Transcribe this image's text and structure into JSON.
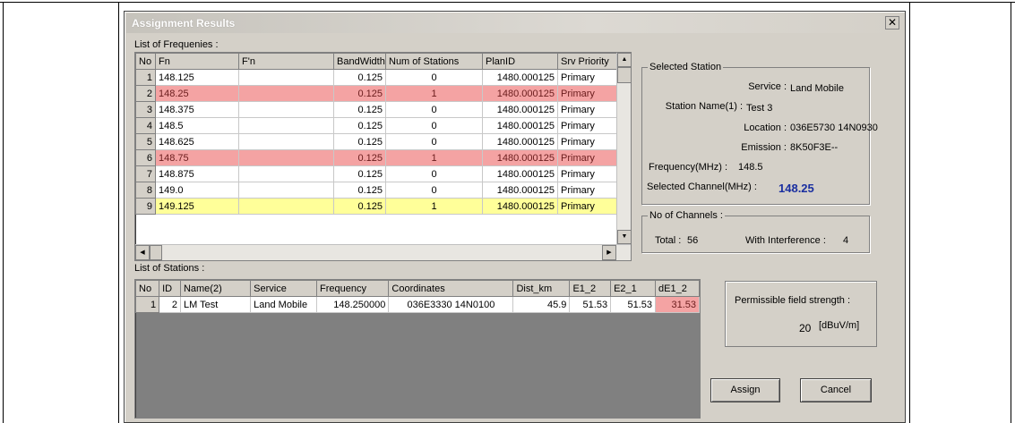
{
  "window": {
    "title": "Assignment Results"
  },
  "frequencies": {
    "label": "List of Frequenies :",
    "columns": [
      "No",
      "Fn",
      "F'n",
      "BandWidth",
      "Num of Stations",
      "PlanID",
      "Srv Priority"
    ],
    "rows": [
      {
        "no": "1",
        "fn": "148.125",
        "fpn": "",
        "bw": "0.125",
        "num": "0",
        "plan": "1480.000125",
        "prio": "Primary",
        "hl": ""
      },
      {
        "no": "2",
        "fn": "148.25",
        "fpn": "",
        "bw": "0.125",
        "num": "1",
        "plan": "1480.000125",
        "prio": "Primary",
        "hl": "pink"
      },
      {
        "no": "3",
        "fn": "148.375",
        "fpn": "",
        "bw": "0.125",
        "num": "0",
        "plan": "1480.000125",
        "prio": "Primary",
        "hl": ""
      },
      {
        "no": "4",
        "fn": "148.5",
        "fpn": "",
        "bw": "0.125",
        "num": "0",
        "plan": "1480.000125",
        "prio": "Primary",
        "hl": ""
      },
      {
        "no": "5",
        "fn": "148.625",
        "fpn": "",
        "bw": "0.125",
        "num": "0",
        "plan": "1480.000125",
        "prio": "Primary",
        "hl": ""
      },
      {
        "no": "6",
        "fn": "148.75",
        "fpn": "",
        "bw": "0.125",
        "num": "1",
        "plan": "1480.000125",
        "prio": "Primary",
        "hl": "pink"
      },
      {
        "no": "7",
        "fn": "148.875",
        "fpn": "",
        "bw": "0.125",
        "num": "0",
        "plan": "1480.000125",
        "prio": "Primary",
        "hl": ""
      },
      {
        "no": "8",
        "fn": "149.0",
        "fpn": "",
        "bw": "0.125",
        "num": "0",
        "plan": "1480.000125",
        "prio": "Primary",
        "hl": ""
      },
      {
        "no": "9",
        "fn": "149.125",
        "fpn": "",
        "bw": "0.125",
        "num": "1",
        "plan": "1480.000125",
        "prio": "Primary",
        "hl": "yellow"
      }
    ]
  },
  "selected_station": {
    "legend": "Selected Station",
    "service_label": "Service :",
    "service_value": "Land Mobile",
    "name_label": "Station Name(1) :",
    "name_value": "Test 3",
    "location_label": "Location :",
    "location_value": "036E5730  14N0930",
    "emission_label": "Emission :",
    "emission_value": "8K50F3E--",
    "frequency_label": "Frequency(MHz) :",
    "frequency_value": "148.5",
    "channel_label": "Selected Channel(MHz) :",
    "channel_value": "148.25"
  },
  "channels": {
    "legend": "No of Channels :",
    "total_label": "Total :",
    "total_value": "56",
    "interference_label": "With Interference :",
    "interference_value": "4"
  },
  "stations": {
    "label": "List of Stations :",
    "columns": [
      "No",
      "ID",
      "Name(2)",
      "Service",
      "Frequency",
      "Coordinates",
      "Dist_km",
      "E1_2",
      "E2_1",
      "dE1_2"
    ],
    "rows": [
      {
        "no": "1",
        "id": "2",
        "name": "LM Test",
        "service": "Land Mobile",
        "freq": "148.250000",
        "coords": "036E3330  14N0100",
        "dist": "45.9",
        "e12": "51.53",
        "e21": "51.53",
        "de12": "31.53"
      }
    ]
  },
  "permissible": {
    "label": "Permissible field strength :",
    "value": "20",
    "unit": "[dBuV/m]"
  },
  "buttons": {
    "assign": "Assign",
    "cancel": "Cancel"
  },
  "colors": {
    "highlight_pink": "#f4a3a3",
    "highlight_yellow": "#ffff99",
    "channel_blue": "#1a2fa0"
  }
}
